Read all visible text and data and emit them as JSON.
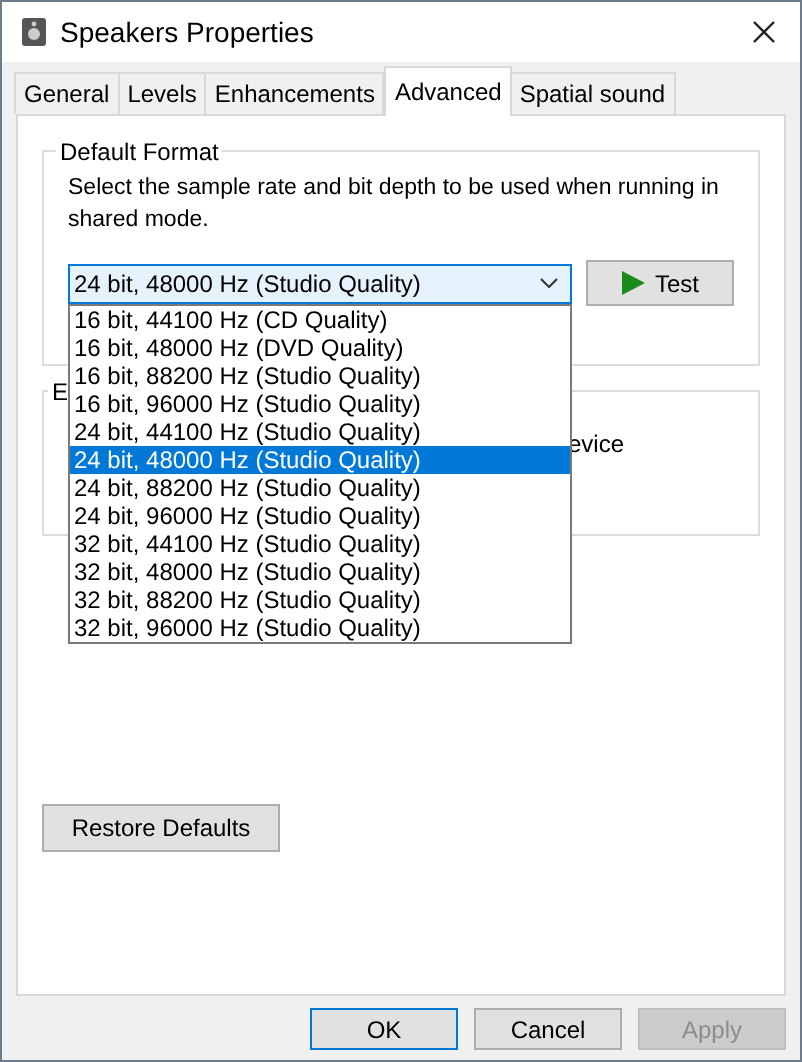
{
  "window": {
    "title": "Speakers Properties"
  },
  "tabs": [
    {
      "label": "General",
      "selected": false
    },
    {
      "label": "Levels",
      "selected": false
    },
    {
      "label": "Enhancements",
      "selected": false
    },
    {
      "label": "Advanced",
      "selected": true
    },
    {
      "label": "Spatial sound",
      "selected": false
    }
  ],
  "default_format": {
    "group_title": "Default Format",
    "description": "Select the sample rate and bit depth to be used when running in shared mode.",
    "format_select": {
      "value": "24 bit, 48000 Hz (Studio Quality)",
      "expanded": true
    },
    "test_button": "Test",
    "options": [
      {
        "label": "16 bit, 44100 Hz (CD Quality)",
        "selected": false
      },
      {
        "label": "16 bit, 48000 Hz (DVD Quality)",
        "selected": false
      },
      {
        "label": "16 bit, 88200 Hz (Studio Quality)",
        "selected": false
      },
      {
        "label": "16 bit, 96000 Hz (Studio Quality)",
        "selected": false
      },
      {
        "label": "24 bit, 44100 Hz (Studio Quality)",
        "selected": false
      },
      {
        "label": "24 bit, 48000 Hz (Studio Quality)",
        "selected": true
      },
      {
        "label": "24 bit, 88200 Hz (Studio Quality)",
        "selected": false
      },
      {
        "label": "24 bit, 96000 Hz (Studio Quality)",
        "selected": false
      },
      {
        "label": "32 bit, 44100 Hz (Studio Quality)",
        "selected": false
      },
      {
        "label": "32 bit, 48000 Hz (Studio Quality)",
        "selected": false
      },
      {
        "label": "32 bit, 88200 Hz (Studio Quality)",
        "selected": false
      },
      {
        "label": "32 bit, 96000 Hz (Studio Quality)",
        "selected": false
      }
    ]
  },
  "exclusive_group": {
    "group_title": "E",
    "text": "evice"
  },
  "restore_defaults_button": "Restore Defaults",
  "buttons": [
    {
      "label": "OK",
      "disabled": false,
      "default": true
    },
    {
      "label": "Cancel",
      "disabled": false,
      "default": false
    },
    {
      "label": "Apply",
      "disabled": true,
      "default": false
    }
  ]
}
